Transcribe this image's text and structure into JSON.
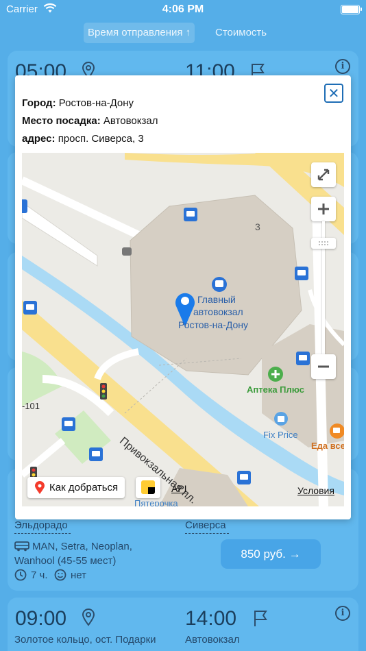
{
  "status_bar": {
    "carrier": "Carrier",
    "time": "4:06 PM"
  },
  "sort": {
    "departure_label": "Время отправления ↑",
    "price_label": "Стоимость"
  },
  "cards": [
    {
      "depart_time": "05:00",
      "arrive_time": "11:00"
    },
    {
      "depart_stop": "Эльдорадо",
      "arrive_stop": "Сиверса",
      "buses": "MAN, Setra, Neoplan,",
      "buses_2": "Wanhool (45-55 мест)",
      "duration": "7 ч.",
      "extra": "нет",
      "price": "850 руб. →"
    },
    {
      "depart_time": "09:00",
      "arrive_time": "14:00",
      "depart_stop": "Золотое кольцо, ост. Подарки",
      "arrive_stop": "Автовокзал"
    }
  ],
  "modal": {
    "close_glyph": "✕",
    "city_label": "Город:",
    "city": "Ростов-на-Дону",
    "place_label": "Место посадка:",
    "place": "Автовокзал",
    "address_label": "адрес:",
    "address": "просп. Сиверса, 3",
    "map": {
      "building_number": "3",
      "station_name_1": "Главный",
      "station_name_2": "автовокзал",
      "station_name_3": "Ростов-на-Дону",
      "pharmacy": "Аптека Плюс",
      "fixprice": "Fix Price",
      "cafe": "Еда все",
      "street": "Привокзальная пл.",
      "road_number": "-101",
      "shop": "Пятерочка",
      "route_button": "Как добраться",
      "api_label": "API",
      "terms_label": "Условия",
      "colors": {
        "road": "#f9e08e",
        "building": "#d6cfc4",
        "water": "#aadaf5",
        "green": "#d0ebc0",
        "pin": "#1a7bea"
      }
    }
  },
  "icons": {
    "wifi": "wifi-icon",
    "pin": "location-pin-icon",
    "flag": "flag-icon",
    "info": "info-icon",
    "bus": "bus-icon",
    "clock": "clock-icon",
    "smile": "smile-icon",
    "close": "close-icon",
    "expand": "expand-icon",
    "plus": "plus-icon",
    "minus": "minus-icon",
    "red_pin": "red-pin-icon",
    "yandex": "yandex-logo-icon"
  }
}
